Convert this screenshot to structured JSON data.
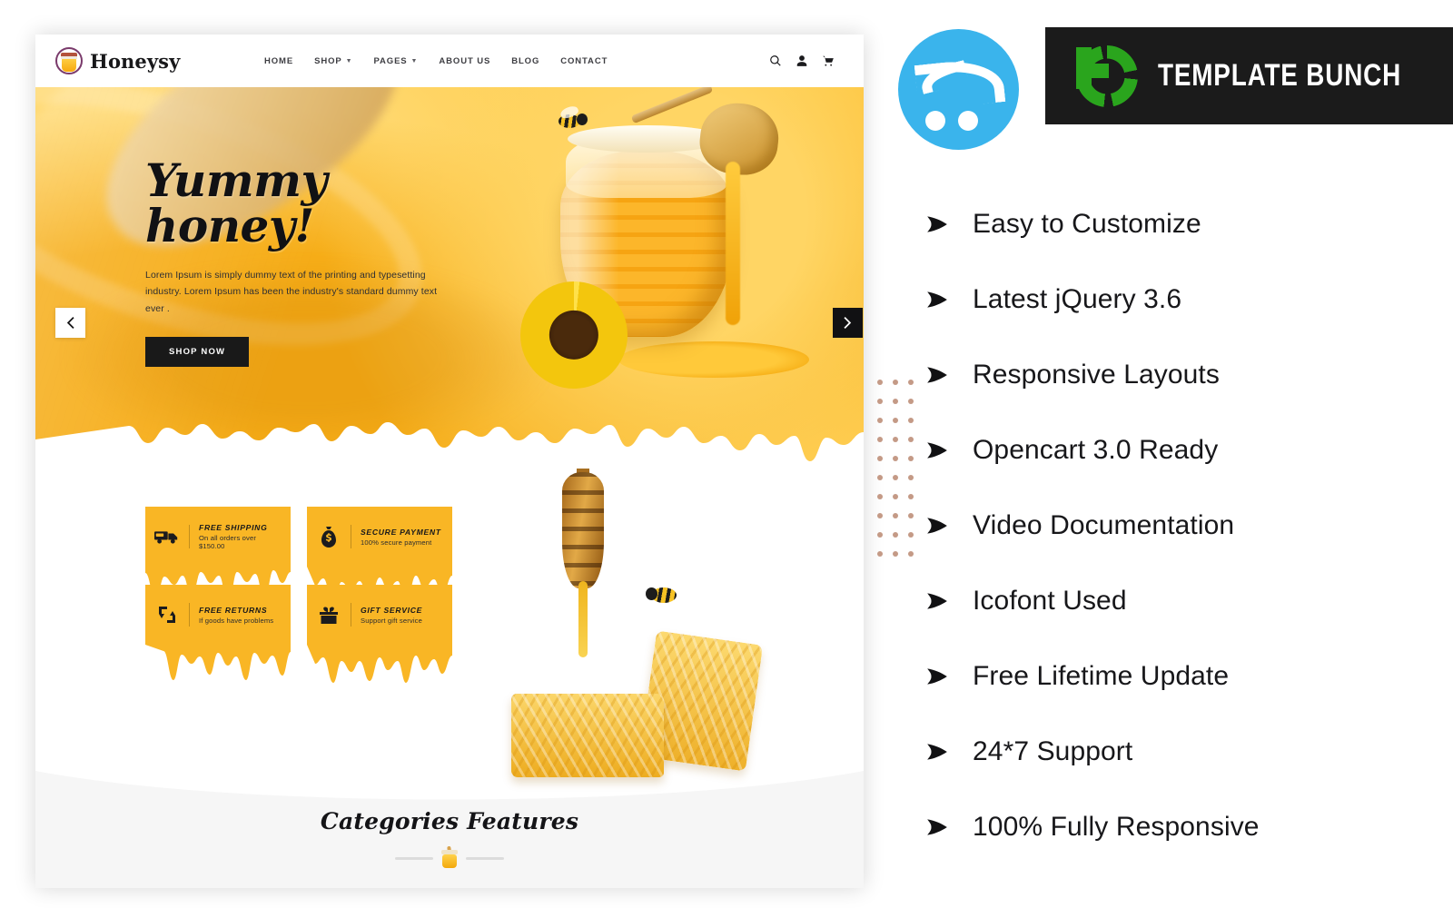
{
  "site": {
    "brand": {
      "name": "Honeysy",
      "icon": "honey-jar-logo-icon"
    },
    "nav": [
      {
        "label": "HOME",
        "has_dropdown": false
      },
      {
        "label": "SHOP",
        "has_dropdown": true
      },
      {
        "label": "PAGES",
        "has_dropdown": true
      },
      {
        "label": "ABOUT US",
        "has_dropdown": false
      },
      {
        "label": "BLOG",
        "has_dropdown": false
      },
      {
        "label": "CONTACT",
        "has_dropdown": false
      }
    ],
    "tools": [
      {
        "name": "search-icon"
      },
      {
        "name": "user-account-icon"
      },
      {
        "name": "shopping-cart-icon"
      }
    ],
    "hero": {
      "title": "Yummy honey!",
      "subtitle": "Lorem Ipsum is simply dummy text of the printing and typesetting industry. Lorem Ipsum has been the industry's standard dummy text ever .",
      "cta": "SHOP NOW",
      "prev_label": "‹",
      "next_label": "›"
    },
    "feature_cards": [
      {
        "icon": "free-shipping-truck-icon",
        "title": "FREE SHIPPING",
        "subtitle": "On all orders over $150.00"
      },
      {
        "icon": "secure-payment-moneybag-icon",
        "title": "SECURE PAYMENT",
        "subtitle": "100% secure payment"
      },
      {
        "icon": "free-returns-exchange-icon",
        "title": "FREE RETURNS",
        "subtitle": "If goods have problems"
      },
      {
        "icon": "gift-service-box-icon",
        "title": "GIFT SERVICE",
        "subtitle": "Support gift service"
      }
    ],
    "categories": {
      "heading": "Categories Features"
    }
  },
  "promo": {
    "opencart_logo": "opencart-cart-logo-icon",
    "brand_banner": {
      "title": "TEMPLATE BUNCH",
      "logo": "template-bunch-tb-logo-icon"
    },
    "features": [
      {
        "label": "Easy to Customize"
      },
      {
        "label": "Latest jQuery 3.6"
      },
      {
        "label": "Responsive Layouts"
      },
      {
        "label": "Opencart 3.0 Ready"
      },
      {
        "label": "Video Documentation"
      },
      {
        "label": "Icofont Used"
      },
      {
        "label": "Free Lifetime Update"
      },
      {
        "label": "24*7 Support"
      },
      {
        "label": "100% Fully Responsive"
      }
    ]
  },
  "colors": {
    "honey": "#f9b625",
    "hero_gradient_start": "#ffc93d",
    "hero_gradient_end": "#f5a90c",
    "dark": "#191919",
    "opencart_blue": "#3ab4ec",
    "template_bunch_green": "#2aa51d",
    "banner_black": "#1b1b1b",
    "dot_grid": "#c49a86",
    "section_bg": "#f6f6f6"
  }
}
